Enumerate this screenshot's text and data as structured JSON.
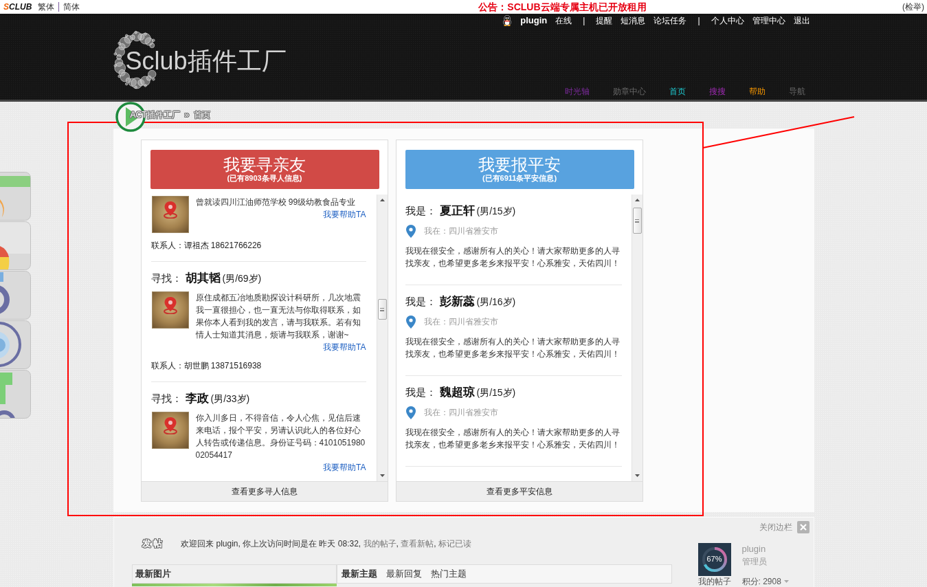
{
  "top_bar": {
    "brand": "SCLUB",
    "languages": [
      "繁体",
      "简体"
    ],
    "announcement": "公告：SCLUB云端专属主机已开放租用",
    "report": "(检举)"
  },
  "header": {
    "user_links": [
      {
        "kind": "user",
        "label": "plugin"
      },
      {
        "kind": "link",
        "label": "在线"
      },
      {
        "kind": "separator",
        "label": "|"
      },
      {
        "kind": "link",
        "label": "提醒"
      },
      {
        "kind": "link",
        "label": "短消息"
      },
      {
        "kind": "link",
        "label": "论坛任务"
      },
      {
        "kind": "separator",
        "label": "|"
      },
      {
        "kind": "link",
        "label": "个人中心"
      },
      {
        "kind": "link",
        "label": "管理中心"
      },
      {
        "kind": "link",
        "label": "退出"
      }
    ],
    "logo_text": "Sclub插件工厂",
    "nav": [
      {
        "label": "时光轴",
        "color": "#7a2a9a"
      },
      {
        "label": "勋章中心",
        "color": "#666666"
      },
      {
        "label": "首页",
        "color": "#1ec8cf"
      },
      {
        "label": "搜搜",
        "color": "#9a2aae"
      },
      {
        "label": "帮助",
        "color": "#f29400"
      },
      {
        "label": "导航",
        "color": "#666666"
      }
    ]
  },
  "breadcrumb": {
    "items": [
      "ACT插件工厂",
      "首页"
    ],
    "separator": "»"
  },
  "panels": [
    {
      "kind": "seek",
      "title": "我要寻亲友",
      "subtitle": "(已有8903条寻人信息)",
      "items": [
        {
          "message": "曾就读四川江油师范学校 99级幼教食品专业",
          "help_link": "我要帮助TA",
          "contact": "联系人：谭祖杰 18621766226"
        },
        {
          "prefix": "寻找：",
          "name": "胡其韬",
          "detail": "(男/69岁)",
          "message": "原住成都五冶地质勘探设计科研所，几次地震我一直很担心，也一直无法与你取得联系，如果你本人看到我的发言，请与我联系。若有知情人士知道其消息，烦请与我联系，谢谢~",
          "help_link": "我要帮助TA",
          "contact": "联系人：胡世鹏 13871516938"
        },
        {
          "prefix": "寻找：",
          "name": "李政",
          "detail": "(男/33岁)",
          "message": "你入川多日，不得音信，令人心焦，见信后速来电话，报个平安，另请认识此人的各位好心人转告或传递信息。身份证号码：410105198002054417",
          "help_link": "我要帮助TA"
        }
      ],
      "more_link": "查看更多寻人信息"
    },
    {
      "kind": "safe",
      "title": "我要报平安",
      "subtitle": "(已有6911条平安信息)",
      "items": [
        {
          "prefix": "我是：",
          "name": "夏正轩",
          "detail": "(男/15岁)",
          "location": "我在：四川省雅安市",
          "message": "我现在很安全，感谢所有人的关心！请大家帮助更多的人寻找亲友，也希望更多老乡来报平安！心系雅安，天佑四川！"
        },
        {
          "prefix": "我是：",
          "name": "彭新蕊",
          "detail": "(男/16岁)",
          "location": "我在：四川省雅安市",
          "message": "我现在很安全，感谢所有人的关心！请大家帮助更多的人寻找亲友，也希望更多老乡来报平安！心系雅安，天佑四川！"
        },
        {
          "prefix": "我是：",
          "name": "魏超琼",
          "detail": "(男/15岁)",
          "location": "我在：四川省雅安市",
          "message": "我现在很安全，感谢所有人的关心！请大家帮助更多的人寻找亲友，也希望更多老乡来报平安！心系雅安，天佑四川！"
        }
      ],
      "more_link": "查看更多平安信息"
    }
  ],
  "bottom": {
    "close_sidebar": "关闭边栏",
    "post_button": "发 帖",
    "welcome": {
      "text": "欢迎回来 plugin, 你上次访问时间是在 昨天 08:32, ",
      "links": [
        "我的帖子",
        "查看新帖",
        "标记已读"
      ],
      "separator": ", "
    },
    "picture_box": {
      "title": "最新图片"
    },
    "topic_tabs": [
      {
        "label": "最新主题",
        "selected": true
      },
      {
        "label": "最新回复",
        "selected": false
      },
      {
        "label": "热门主题",
        "selected": false
      }
    ],
    "user_card": {
      "progress": {
        "level": 0.67,
        "label": "67%"
      },
      "username": "plugin",
      "role": "管理员",
      "my_posts": "我的帖子",
      "points": "积分: 2908"
    }
  }
}
